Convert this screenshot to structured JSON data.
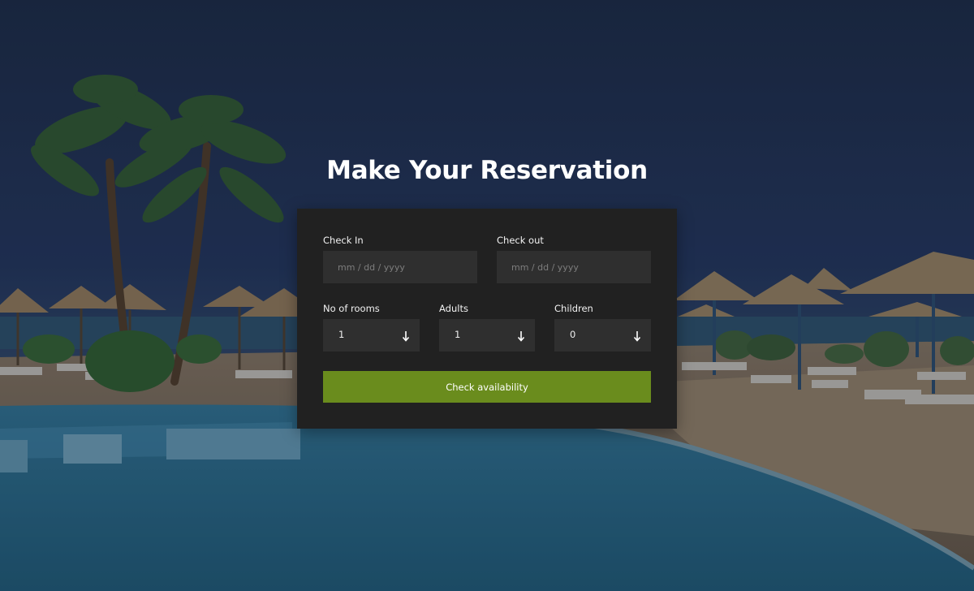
{
  "page": {
    "title": "Make Your Reservation"
  },
  "form": {
    "check_in": {
      "label": "Check In",
      "placeholder": "mm / dd / yyyy",
      "value": ""
    },
    "check_out": {
      "label": "Check out",
      "placeholder": "mm / dd / yyyy",
      "value": ""
    },
    "rooms": {
      "label": "No of rooms",
      "value": "1"
    },
    "adults": {
      "label": "Adults",
      "value": "1"
    },
    "children": {
      "label": "Children",
      "value": "0"
    },
    "submit_label": "Check availability"
  },
  "colors": {
    "card_background": "#212121",
    "field_background": "#2f2f2f",
    "button": "#6a8c1d",
    "text": "#ffffff"
  },
  "icons": {
    "select_arrow": "arrow-down-icon"
  }
}
